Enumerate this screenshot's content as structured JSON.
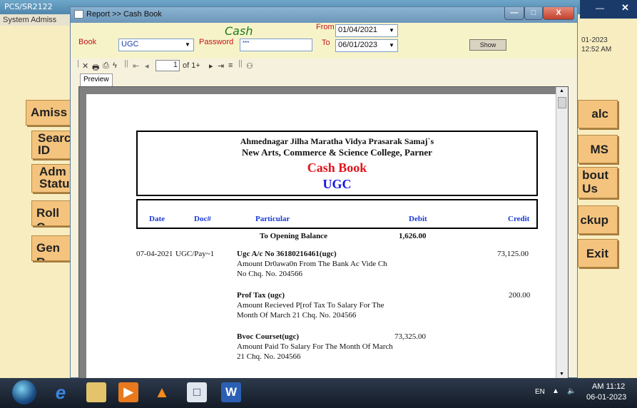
{
  "background_app": {
    "title": "PCS/SR2122",
    "menu": "System  Admiss",
    "left_buttons": [
      "Amiss",
      "Searc\nID",
      "Adm\nStatu",
      "Roll C",
      "Gen R"
    ],
    "right_buttons": [
      "alc",
      "MS",
      "bout\nUs",
      "ckup",
      "Exit"
    ],
    "info_date": "01-2023",
    "info_time": "12:52 AM"
  },
  "report_window": {
    "title": "Report >> Cash Book",
    "controls": {
      "minimize": "—",
      "maximize": "□",
      "close": "X"
    }
  },
  "toolbar": {
    "cash_title": "Cash",
    "book_label": "Book",
    "book_value": "UGC",
    "password_label": "Password",
    "password_value": "***",
    "from_label": "From",
    "from_value": "01/04/2021",
    "to_label": "To",
    "to_value": "06/01/2023",
    "show_label": "Show"
  },
  "viewer": {
    "page_input": "1",
    "page_of": "of 1+",
    "tab_preview": "Preview"
  },
  "report": {
    "org_line1": "Ahmednagar Jilha Maratha Vidya Prasarak Samaj`s",
    "org_line2": "New Arts, Commerce & Science College, Parner",
    "title": "Cash Book",
    "subtitle": "UGC",
    "columns": {
      "date": "Date",
      "doc": "Doc#",
      "particular": "Particular",
      "debit": "Debit",
      "credit": "Credit"
    },
    "opening": {
      "label": "To Opening Balance",
      "debit": "1,626.00"
    },
    "entries": [
      {
        "date": "07-04-2021",
        "doc": "UGC/Pay~1",
        "head": "Ugc A/c No 36180216461(ugc)",
        "detail1": "Amount Dr0awa0n From The Bank Ac Vide Ch",
        "detail2": "No Chq. No. 204566",
        "debit": "",
        "credit": "73,125.00"
      },
      {
        "date": "",
        "doc": "",
        "head": "Prof Tax (ugc)",
        "detail1": "Amount  Recieved P[rof Tax To Salary For The",
        "detail2": "Month Of March 21 Chq. No. 204566",
        "debit": "",
        "credit": "200.00"
      },
      {
        "date": "",
        "doc": "",
        "head": "Bvoc Courset(ugc)",
        "detail1": "Amount Paid To Salary For The Month Of March",
        "detail2": "21 Chq. No. 204566",
        "debit": "73,325.00",
        "credit": ""
      }
    ]
  },
  "taskbar": {
    "lang": "EN",
    "time": "AM 11:12",
    "date": "06-01-2023"
  },
  "colors": {
    "accent_button": "#f4c47e",
    "header_red": "#e3141c",
    "header_blue": "#1414e6"
  }
}
